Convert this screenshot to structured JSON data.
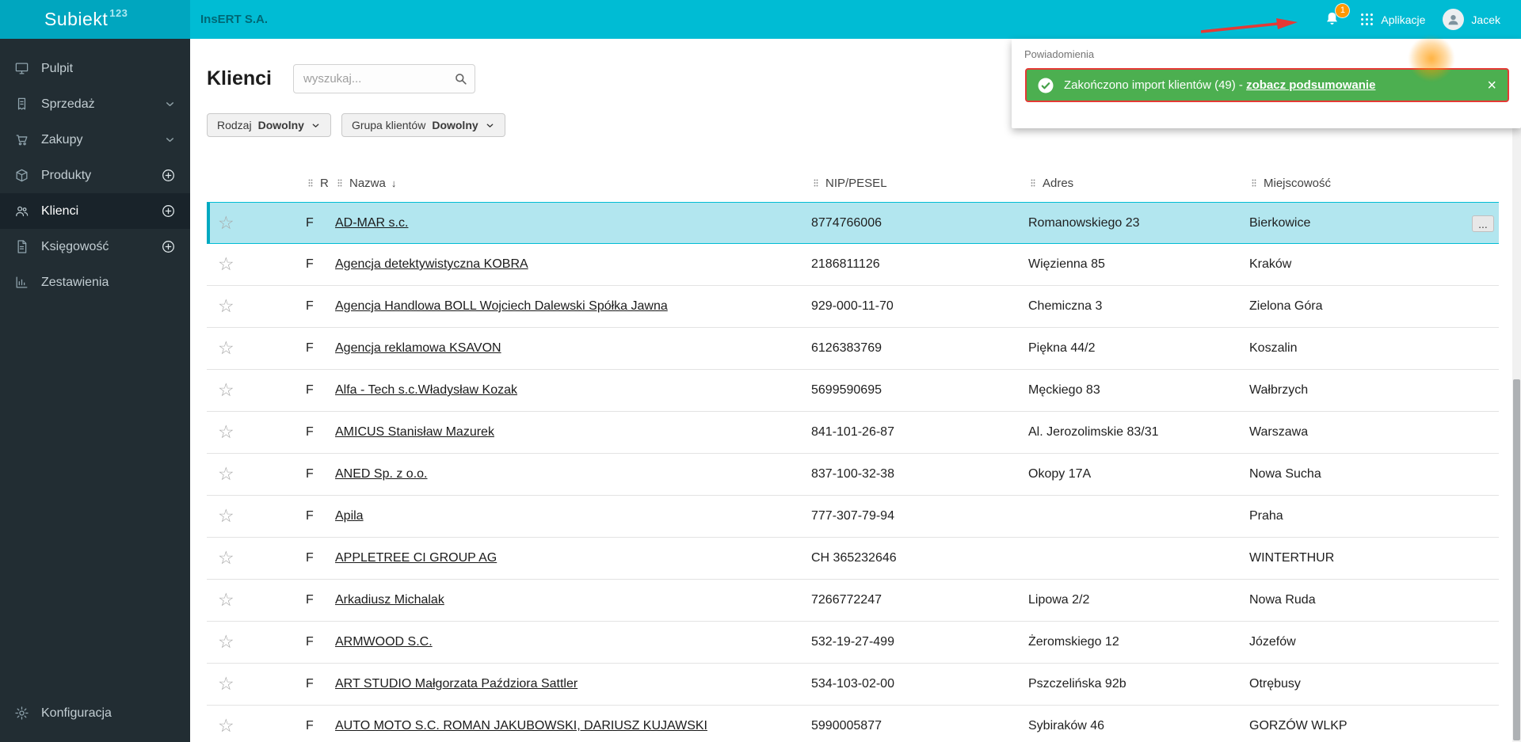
{
  "topbar": {
    "brand": "Subiekt",
    "brand_sup": "123",
    "company": "InsERT S.A.",
    "notifications_count": "1",
    "apps_label": "Aplikacje",
    "user_name": "Jacek"
  },
  "sidebar": {
    "items": [
      {
        "label": "Pulpit",
        "icon": "desktop-icon"
      },
      {
        "label": "Sprzedaż",
        "icon": "sales-icon",
        "suffix": "chevron"
      },
      {
        "label": "Zakupy",
        "icon": "purchases-icon",
        "suffix": "chevron"
      },
      {
        "label": "Produkty",
        "icon": "products-icon",
        "suffix": "plus"
      },
      {
        "label": "Klienci",
        "icon": "clients-icon",
        "suffix": "plus",
        "active": true
      },
      {
        "label": "Księgowość",
        "icon": "accounting-icon",
        "suffix": "plus"
      },
      {
        "label": "Zestawienia",
        "icon": "reports-icon"
      }
    ],
    "bottom": {
      "label": "Konfiguracja",
      "icon": "gear-icon"
    }
  },
  "main": {
    "title": "Klienci",
    "search_placeholder": "wyszukaj...",
    "filters": [
      {
        "label": "Rodzaj",
        "value": "Dowolny"
      },
      {
        "label": "Grupa klientów",
        "value": "Dowolny"
      }
    ],
    "table": {
      "columns": [
        {
          "key": "type",
          "label": "R"
        },
        {
          "key": "name",
          "label": "Nazwa",
          "sorted": "desc"
        },
        {
          "key": "nip",
          "label": "NIP/PESEL"
        },
        {
          "key": "address",
          "label": "Adres"
        },
        {
          "key": "city",
          "label": "Miejscowość"
        }
      ],
      "rows": [
        {
          "type": "F",
          "name": "AD-MAR s.c.",
          "nip": "8774766006",
          "address": "Romanowskiego 23",
          "city": "Bierkowice",
          "selected": true
        },
        {
          "type": "F",
          "name": "Agencja detektywistyczna KOBRA",
          "nip": "2186811126",
          "address": "Więzienna 85",
          "city": "Kraków"
        },
        {
          "type": "F",
          "name": "Agencja Handlowa BOLL Wojciech Dalewski Spółka Jawna",
          "nip": "929-000-11-70",
          "address": "Chemiczna 3",
          "city": "Zielona Góra"
        },
        {
          "type": "F",
          "name": "Agencja reklamowa KSAVON",
          "nip": "6126383769",
          "address": "Piękna 44/2",
          "city": "Koszalin"
        },
        {
          "type": "F",
          "name": "Alfa - Tech s.c.Władysław Kozak",
          "nip": "5699590695",
          "address": "Męckiego 83",
          "city": "Wałbrzych"
        },
        {
          "type": "F",
          "name": "AMICUS Stanisław Mazurek",
          "nip": "841-101-26-87",
          "address": "Al. Jerozolimskie 83/31",
          "city": "Warszawa"
        },
        {
          "type": "F",
          "name": "ANED Sp. z o.o.",
          "nip": "837-100-32-38",
          "address": "Okopy 17A",
          "city": "Nowa Sucha"
        },
        {
          "type": "F",
          "name": "Apila",
          "nip": "777-307-79-94",
          "address": "",
          "city": "Praha"
        },
        {
          "type": "F",
          "name": "APPLETREE CI GROUP AG",
          "nip": "CH 365232646",
          "address": "",
          "city": "WINTERTHUR"
        },
        {
          "type": "F",
          "name": "Arkadiusz Michalak",
          "nip": "7266772247",
          "address": "Lipowa 2/2",
          "city": "Nowa Ruda"
        },
        {
          "type": "F",
          "name": "ARMWOOD S.C.",
          "nip": "532-19-27-499",
          "address": "Żeromskiego 12",
          "city": "Józefów"
        },
        {
          "type": "F",
          "name": "ART STUDIO Małgorzata Paździora Sattler",
          "nip": "534-103-02-00",
          "address": "Pszczelińska 92b",
          "city": "Otrębusy"
        },
        {
          "type": "F",
          "name": "AUTO MOTO S.C. ROMAN JAKUBOWSKI, DARIUSZ KUJAWSKI",
          "nip": "5990005877",
          "address": "Sybiraków 46",
          "city": "GORZÓW WLKP"
        }
      ]
    }
  },
  "notifications": {
    "panel_title": "Powiadomienia",
    "toast": {
      "message": "Zakończono import klientów (49) - ",
      "link_label": "zobacz podsumowanie",
      "close_label": "×"
    }
  },
  "colors": {
    "topbar": "#00bcd4",
    "accent": "#00bcd4",
    "selected_row": "#b2e6ef",
    "toast_green": "#4caf50",
    "toast_red": "#e53935",
    "badge_orange": "#ff9800",
    "sidebar_bg": "#222d33"
  }
}
